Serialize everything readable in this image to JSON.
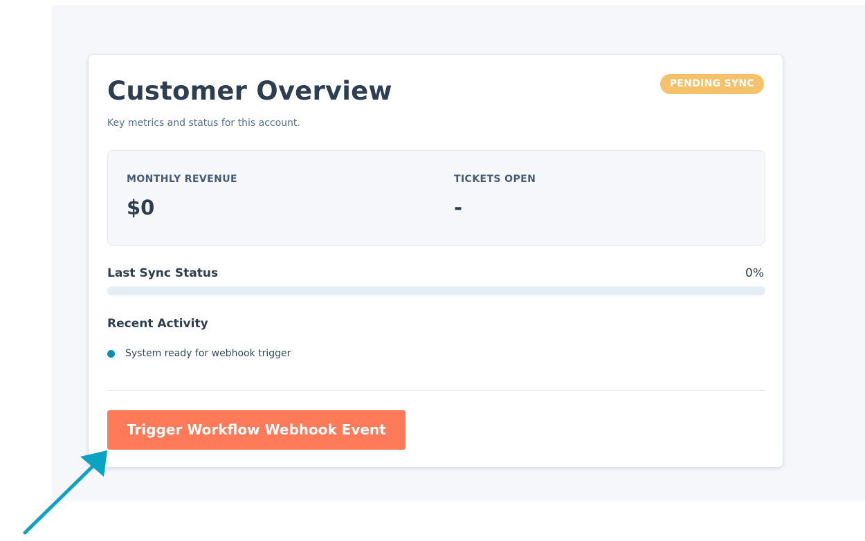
{
  "card": {
    "title": "Customer Overview",
    "subtitle": "Key metrics and status for this account.",
    "badge": "PENDING SYNC"
  },
  "metrics": {
    "revenue": {
      "label": "MONTHLY REVENUE",
      "value": "$0"
    },
    "tickets": {
      "label": "TICKETS OPEN",
      "value": "-"
    }
  },
  "sync": {
    "label": "Last Sync Status",
    "percent_text": "0%",
    "progress_fraction": 0
  },
  "activity": {
    "heading": "Recent Activity",
    "items": [
      {
        "text": "System ready for webhook trigger"
      }
    ]
  },
  "actions": {
    "trigger_label": "Trigger Workflow Webhook Event"
  },
  "colors": {
    "badge": "#f5c26b",
    "button": "#ff7a59",
    "accent": "#0091ae",
    "annotation_arrow": "#0aa3c2"
  },
  "icons": {
    "activity_bullet": "dot-icon",
    "annotation": "arrow-pointer-icon"
  }
}
